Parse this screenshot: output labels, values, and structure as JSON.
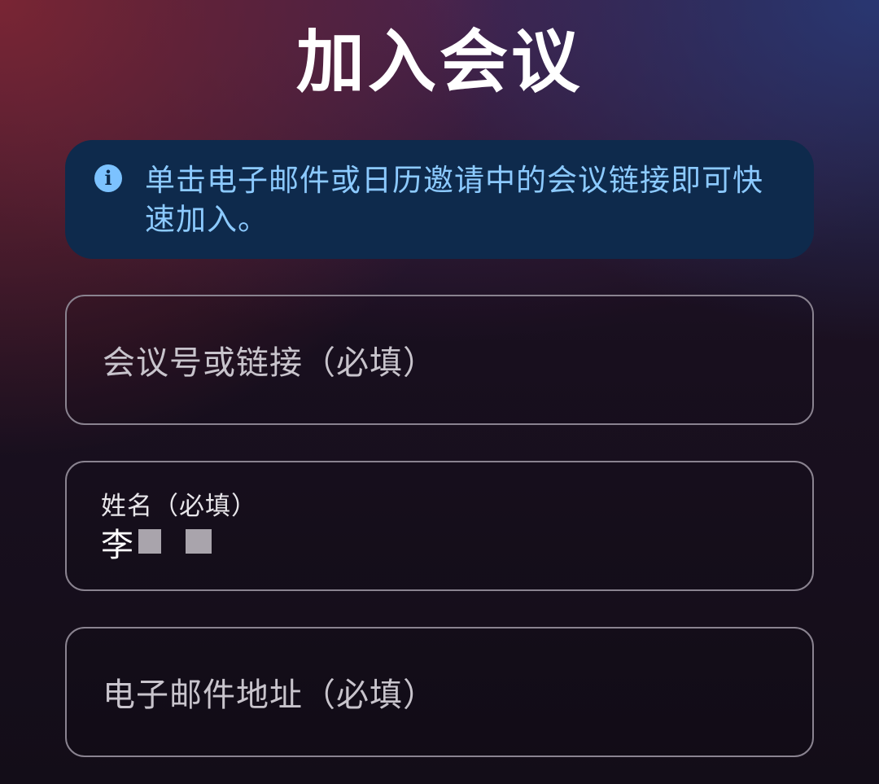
{
  "title": "加入会议",
  "info_banner": {
    "icon": "info-icon",
    "text": "单击电子邮件或日历邀请中的会议链接即可快速加入。"
  },
  "fields": {
    "meeting_id": {
      "placeholder": "会议号或链接（必填）"
    },
    "name": {
      "label": "姓名（必填）",
      "value": "李"
    },
    "email": {
      "placeholder": "电子邮件地址（必填）"
    }
  },
  "colors": {
    "banner_bg": "#0e2a4c",
    "banner_text": "#8ccaff",
    "field_border": "#8a8390"
  }
}
